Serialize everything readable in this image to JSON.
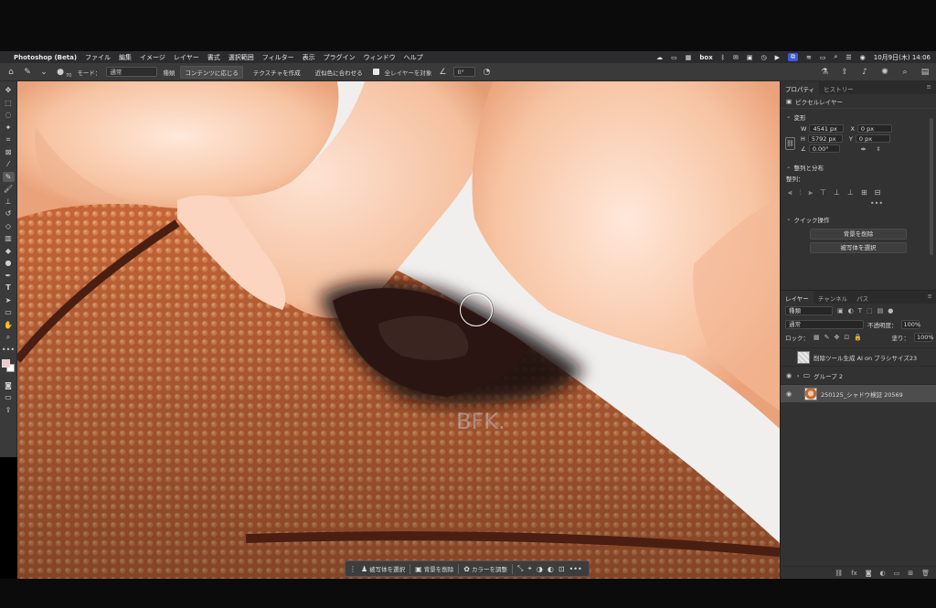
{
  "menubar": {
    "app_name": "Photoshop (Beta)",
    "items": [
      "ファイル",
      "編集",
      "イメージ",
      "レイヤー",
      "書式",
      "選択範囲",
      "フィルター",
      "表示",
      "プラグイン",
      "ウィンドウ",
      "ヘルプ"
    ],
    "status_icon_label": "box",
    "datetime": "10月9日(木) 14:06"
  },
  "options_bar": {
    "brush_size": "70",
    "mode_label": "モード：",
    "mode_value": "通常",
    "type_label": "種類",
    "btn_content_aware": "コンテンツに応じる",
    "btn_create_texture": "テクスチャを作成",
    "btn_proximity_match": "近似色に合わせる",
    "sample_all_layers": "全レイヤーを対象",
    "angle_value": "0°"
  },
  "properties": {
    "tab_properties": "プロパティ",
    "tab_history": "ヒストリー",
    "layer_type": "ピクセルレイヤー",
    "transform_title": "変形",
    "w_label": "W",
    "w_value": "4541 px",
    "h_label": "H",
    "h_value": "5792 px",
    "x_label": "X",
    "x_value": "0 px",
    "y_label": "Y",
    "y_value": "0 px",
    "angle_value": "0.00°",
    "align_title": "整列と分布",
    "align_sub": "整列：",
    "quick_actions_title": "クイック操作",
    "btn_remove_bg": "背景を削除",
    "btn_select_subject": "被写体を選択",
    "more": "•••"
  },
  "layers_panel": {
    "tab_layers": "レイヤー",
    "tab_channels": "チャンネル",
    "tab_paths": "パス",
    "filter_kind": "種類",
    "blend_mode": "通常",
    "opacity_label": "不透明度：",
    "opacity_value": "100%",
    "lock_label": "ロック：",
    "fill_label": "塗り：",
    "fill_value": "100%",
    "layers": [
      {
        "name": "削除ツール生成 AI on ブラシサイズ23",
        "visible": false,
        "kind": "pixel"
      },
      {
        "name": "グループ 2",
        "visible": true,
        "kind": "group"
      },
      {
        "name": "250125_シャドウ検証 20569",
        "visible": true,
        "kind": "photo"
      }
    ]
  },
  "taskbar": {
    "select_subject": "被写体を選択",
    "remove_background": "背景を削除",
    "color_adjust": "カラーを調整",
    "more": "•••"
  },
  "colors": {
    "accent": "#2f6fd9",
    "foreground_swatch": "#f1c7cc",
    "background_swatch": "#ffffff"
  }
}
